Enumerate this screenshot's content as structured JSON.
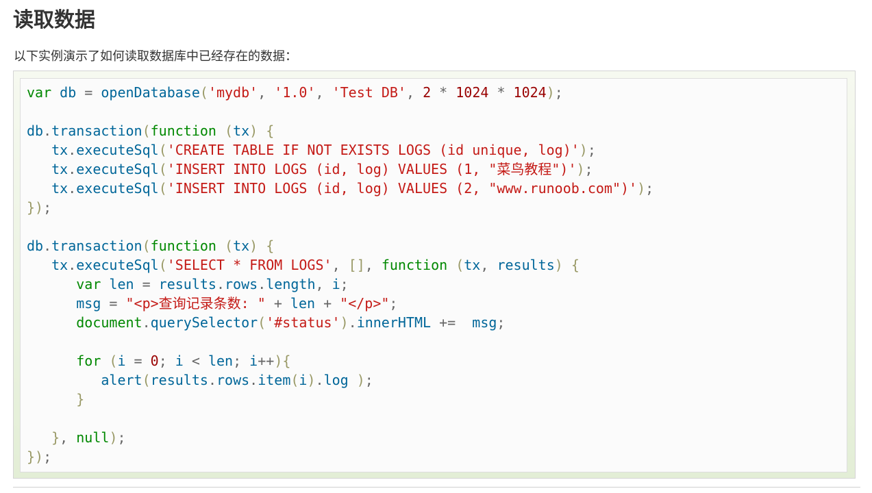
{
  "heading": "读取数据",
  "intro": "以下实例演示了如何读取数据库中已经存在的数据：",
  "code": {
    "language": "javascript",
    "colors": {
      "keyword": "#008800",
      "identifier": "#006699",
      "string": "#c41a16",
      "number": "#990000",
      "punctuation": "#999966",
      "operator": "#666666",
      "frame_gradient_top": "#f6f9f0",
      "frame_gradient_bottom": "#e3eed6"
    },
    "lines": [
      [
        [
          "kw",
          "var"
        ],
        [
          "p",
          " "
        ],
        [
          "id",
          "db"
        ],
        [
          "p",
          " = "
        ],
        [
          "id",
          "openDatabase"
        ],
        [
          "pu",
          "("
        ],
        [
          "s",
          "'mydb'"
        ],
        [
          "p",
          ", "
        ],
        [
          "s",
          "'1.0'"
        ],
        [
          "p",
          ", "
        ],
        [
          "s",
          "'Test DB'"
        ],
        [
          "p",
          ", "
        ],
        [
          "n",
          "2"
        ],
        [
          "p",
          " * "
        ],
        [
          "n",
          "1024"
        ],
        [
          "p",
          " * "
        ],
        [
          "n",
          "1024"
        ],
        [
          "pu",
          ")"
        ],
        [
          "p",
          ";"
        ]
      ],
      [],
      [
        [
          "id",
          "db"
        ],
        [
          "p",
          "."
        ],
        [
          "id",
          "transaction"
        ],
        [
          "pu",
          "("
        ],
        [
          "kw",
          "function"
        ],
        [
          "p",
          " "
        ],
        [
          "pu",
          "("
        ],
        [
          "id",
          "tx"
        ],
        [
          "pu",
          ")"
        ],
        [
          "p",
          " "
        ],
        [
          "pu",
          "{"
        ]
      ],
      [
        [
          "p",
          "   "
        ],
        [
          "id",
          "tx"
        ],
        [
          "p",
          "."
        ],
        [
          "id",
          "executeSql"
        ],
        [
          "pu",
          "("
        ],
        [
          "s",
          "'CREATE TABLE IF NOT EXISTS LOGS (id unique, log)'"
        ],
        [
          "pu",
          ")"
        ],
        [
          "p",
          ";"
        ]
      ],
      [
        [
          "p",
          "   "
        ],
        [
          "id",
          "tx"
        ],
        [
          "p",
          "."
        ],
        [
          "id",
          "executeSql"
        ],
        [
          "pu",
          "("
        ],
        [
          "s",
          "'INSERT INTO LOGS (id, log) VALUES (1, \"菜鸟教程\")'"
        ],
        [
          "pu",
          ")"
        ],
        [
          "p",
          ";"
        ]
      ],
      [
        [
          "p",
          "   "
        ],
        [
          "id",
          "tx"
        ],
        [
          "p",
          "."
        ],
        [
          "id",
          "executeSql"
        ],
        [
          "pu",
          "("
        ],
        [
          "s",
          "'INSERT INTO LOGS (id, log) VALUES (2, \"www.runoob.com\")'"
        ],
        [
          "pu",
          ")"
        ],
        [
          "p",
          ";"
        ]
      ],
      [
        [
          "pu",
          "})"
        ],
        [
          "p",
          ";"
        ]
      ],
      [],
      [
        [
          "id",
          "db"
        ],
        [
          "p",
          "."
        ],
        [
          "id",
          "transaction"
        ],
        [
          "pu",
          "("
        ],
        [
          "kw",
          "function"
        ],
        [
          "p",
          " "
        ],
        [
          "pu",
          "("
        ],
        [
          "id",
          "tx"
        ],
        [
          "pu",
          ")"
        ],
        [
          "p",
          " "
        ],
        [
          "pu",
          "{"
        ]
      ],
      [
        [
          "p",
          "   "
        ],
        [
          "id",
          "tx"
        ],
        [
          "p",
          "."
        ],
        [
          "id",
          "executeSql"
        ],
        [
          "pu",
          "("
        ],
        [
          "s",
          "'SELECT * FROM LOGS'"
        ],
        [
          "p",
          ", "
        ],
        [
          "pu",
          "[]"
        ],
        [
          "p",
          ", "
        ],
        [
          "kw",
          "function"
        ],
        [
          "p",
          " "
        ],
        [
          "pu",
          "("
        ],
        [
          "id",
          "tx"
        ],
        [
          "p",
          ", "
        ],
        [
          "id",
          "results"
        ],
        [
          "pu",
          ")"
        ],
        [
          "p",
          " "
        ],
        [
          "pu",
          "{"
        ]
      ],
      [
        [
          "p",
          "      "
        ],
        [
          "kw",
          "var"
        ],
        [
          "p",
          " "
        ],
        [
          "id",
          "len"
        ],
        [
          "p",
          " = "
        ],
        [
          "id",
          "results"
        ],
        [
          "p",
          "."
        ],
        [
          "id",
          "rows"
        ],
        [
          "p",
          "."
        ],
        [
          "id",
          "length"
        ],
        [
          "p",
          ", "
        ],
        [
          "id",
          "i"
        ],
        [
          "p",
          ";"
        ]
      ],
      [
        [
          "p",
          "      "
        ],
        [
          "id",
          "msg"
        ],
        [
          "p",
          " = "
        ],
        [
          "s",
          "\"<p>查询记录条数: \""
        ],
        [
          "p",
          " + "
        ],
        [
          "id",
          "len"
        ],
        [
          "p",
          " + "
        ],
        [
          "s",
          "\"</p>\""
        ],
        [
          "p",
          ";"
        ]
      ],
      [
        [
          "p",
          "      "
        ],
        [
          "kw",
          "document"
        ],
        [
          "p",
          "."
        ],
        [
          "id",
          "querySelector"
        ],
        [
          "pu",
          "("
        ],
        [
          "s",
          "'#status'"
        ],
        [
          "pu",
          ")"
        ],
        [
          "p",
          "."
        ],
        [
          "id",
          "innerHTML"
        ],
        [
          "p",
          " +=  "
        ],
        [
          "id",
          "msg"
        ],
        [
          "p",
          ";"
        ]
      ],
      [],
      [
        [
          "p",
          "      "
        ],
        [
          "kw",
          "for"
        ],
        [
          "p",
          " "
        ],
        [
          "pu",
          "("
        ],
        [
          "id",
          "i"
        ],
        [
          "p",
          " = "
        ],
        [
          "n",
          "0"
        ],
        [
          "p",
          "; "
        ],
        [
          "id",
          "i"
        ],
        [
          "p",
          " < "
        ],
        [
          "id",
          "len"
        ],
        [
          "p",
          "; "
        ],
        [
          "id",
          "i"
        ],
        [
          "p",
          "++"
        ],
        [
          "pu",
          "){"
        ]
      ],
      [
        [
          "p",
          "         "
        ],
        [
          "id",
          "alert"
        ],
        [
          "pu",
          "("
        ],
        [
          "id",
          "results"
        ],
        [
          "p",
          "."
        ],
        [
          "id",
          "rows"
        ],
        [
          "p",
          "."
        ],
        [
          "id",
          "item"
        ],
        [
          "pu",
          "("
        ],
        [
          "id",
          "i"
        ],
        [
          "pu",
          ")"
        ],
        [
          "p",
          "."
        ],
        [
          "id",
          "log"
        ],
        [
          "p",
          " "
        ],
        [
          "pu",
          ")"
        ],
        [
          "p",
          ";"
        ]
      ],
      [
        [
          "p",
          "      "
        ],
        [
          "pu",
          "}"
        ]
      ],
      [],
      [
        [
          "p",
          "   "
        ],
        [
          "pu",
          "}"
        ],
        [
          "p",
          ", "
        ],
        [
          "kw",
          "null"
        ],
        [
          "pu",
          ")"
        ],
        [
          "p",
          ";"
        ]
      ],
      [
        [
          "pu",
          "})"
        ],
        [
          "p",
          ";"
        ]
      ]
    ]
  }
}
